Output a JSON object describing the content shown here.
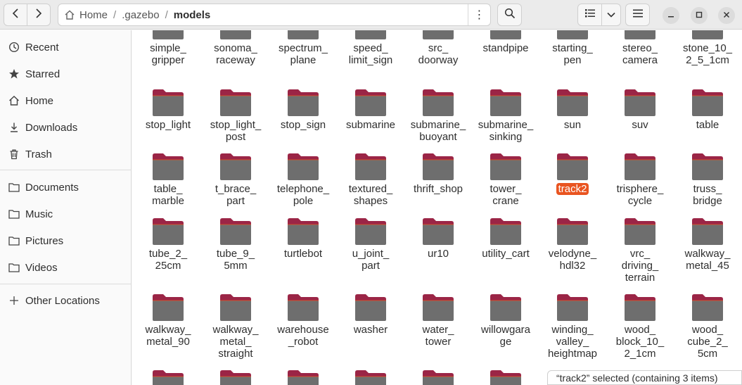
{
  "nav": {
    "back_icon": "chevron-left-icon",
    "forward_icon": "chevron-right-icon"
  },
  "path": {
    "home_label": "Home",
    "sep": "/",
    "crumb2": ".gazebo",
    "crumb3": "models",
    "menu_icon": "⋮"
  },
  "toolbar": {
    "search_icon": "search-icon",
    "list_icon": "list-view-icon",
    "drop_icon": "chevron-down-icon",
    "menu_icon": "hamburger-icon"
  },
  "window": {
    "min": "minimize-icon",
    "max": "maximize-icon",
    "close": "close-icon"
  },
  "sidebar": {
    "items": [
      {
        "label": "Recent",
        "icon": "clock-icon"
      },
      {
        "label": "Starred",
        "icon": "star-icon"
      },
      {
        "label": "Home",
        "icon": "home-icon"
      },
      {
        "label": "Downloads",
        "icon": "download-icon"
      },
      {
        "label": "Trash",
        "icon": "trash-icon"
      },
      {
        "label": "Documents",
        "icon": "folder-icon"
      },
      {
        "label": "Music",
        "icon": "folder-icon"
      },
      {
        "label": "Pictures",
        "icon": "folder-icon"
      },
      {
        "label": "Videos",
        "icon": "folder-icon"
      },
      {
        "label": "Other Locations",
        "icon": "plus-icon"
      }
    ]
  },
  "colors": {
    "accent": "#e95420",
    "folder_tab": "#9b2546",
    "folder_body": "#6e6e6e"
  },
  "rows": [
    [
      "simple_\ngripper",
      "sonoma_\nraceway",
      "spectrum_\nplane",
      "speed_\nlimit_sign",
      "src_\ndoorway",
      "standpipe",
      "starting_\npen",
      "stereo_\ncamera",
      "stone_10_\n2_5_1cm"
    ],
    [
      "stop_light",
      "stop_light_\npost",
      "stop_sign",
      "submarine",
      "submarine_\nbuoyant",
      "submarine_\nsinking",
      "sun",
      "suv",
      "table"
    ],
    [
      "table_\nmarble",
      "t_brace_\npart",
      "telephone_\npole",
      "textured_\nshapes",
      "thrift_shop",
      "tower_\ncrane",
      "track2",
      "trisphere_\ncycle",
      "truss_\nbridge"
    ],
    [
      "tube_2_\n25cm",
      "tube_9_\n5mm",
      "turtlebot",
      "u_joint_\npart",
      "ur10",
      "utility_cart",
      "velodyne_\nhdl32",
      "vrc_\ndriving_\nterrain",
      "walkway_\nmetal_45"
    ],
    [
      "walkway_\nmetal_90",
      "walkway_\nmetal_\nstraight",
      "warehouse\n_robot",
      "washer",
      "water_\ntower",
      "willowgara\nge",
      "winding_\nvalley_\nheightmap",
      "wood_\nblock_10_\n2_1cm",
      "wood_\ncube_2_\n5cm"
    ]
  ],
  "selected": "track2",
  "status": "“track2” selected  (containing 3 items)"
}
